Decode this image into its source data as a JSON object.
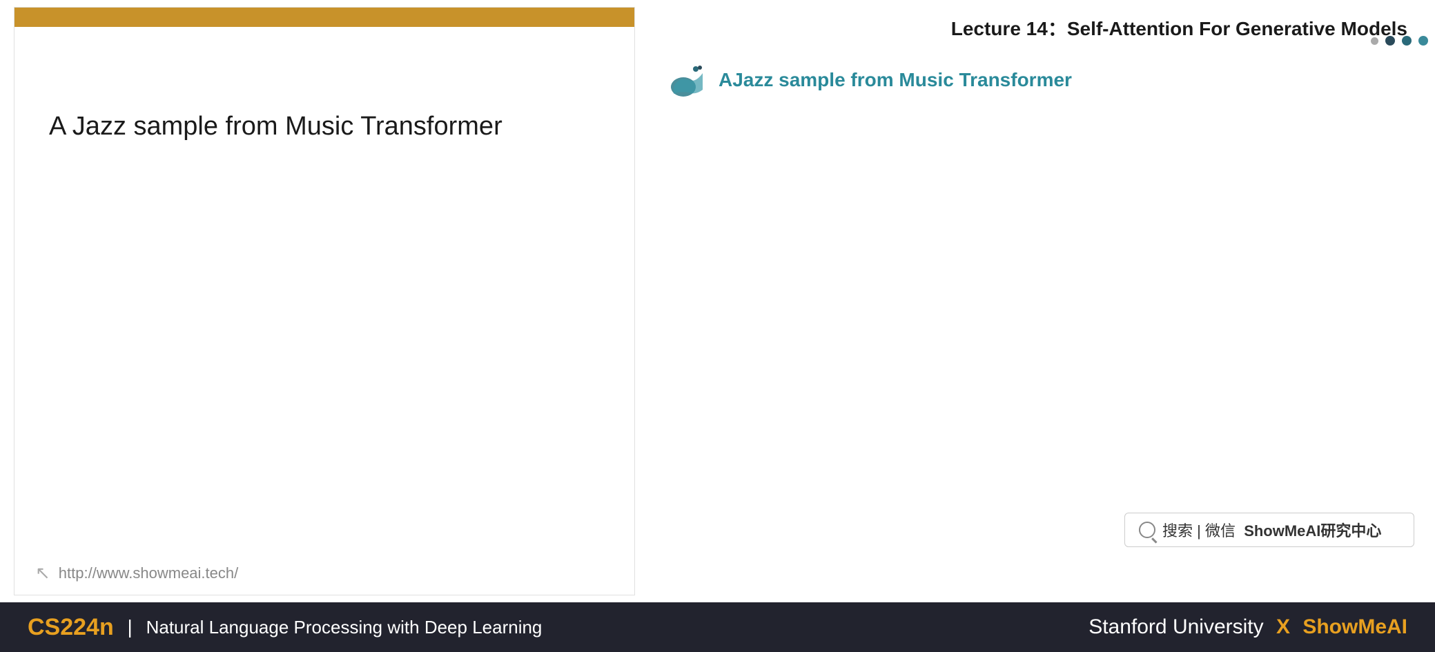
{
  "lecture": {
    "title": "Lecture 14：Self-Attention For Generative Models"
  },
  "slide": {
    "top_bar_color": "#c8922a",
    "title": "A Jazz sample from Music Transformer",
    "footer_url": "http://www.showmeai.tech/",
    "footer_icon": "↖"
  },
  "playlist": {
    "active_item": {
      "title": "AJazz sample from Music Transformer"
    }
  },
  "search": {
    "label": "搜索 | 微信",
    "brand": "ShowMeAI研究中心"
  },
  "bottom_bar": {
    "course_code": "CS224n",
    "separator": "|",
    "course_name": "Natural Language Processing with Deep Learning",
    "university": "Stanford University",
    "x_mark": "X",
    "brand": "ShowMeAI"
  },
  "dots": {
    "left_dot_color": "#aaaaaa",
    "dark_dot_color": "#1e3d4f",
    "medium_dot_color": "#1e6878",
    "light_dot_color": "#2a8a9a"
  }
}
